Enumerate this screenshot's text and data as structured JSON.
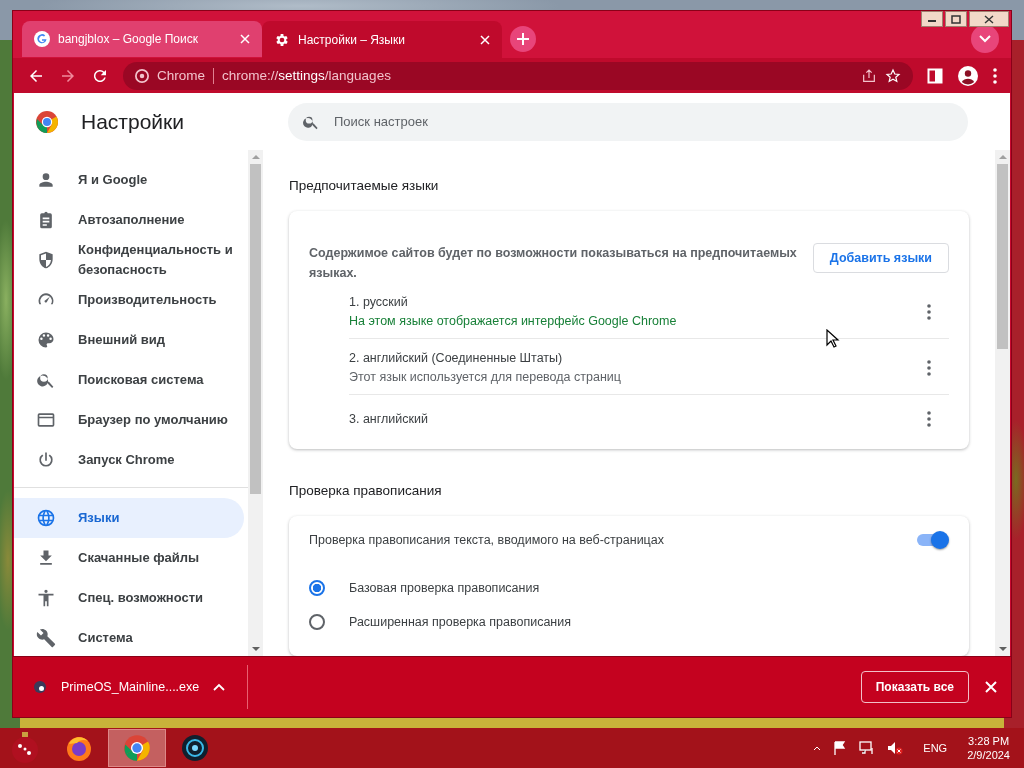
{
  "tabs": [
    {
      "title": "bangjblox – Google Поиск",
      "selected": false
    },
    {
      "title": "Настройки – Языки",
      "selected": true
    }
  ],
  "address_bar": {
    "site_chip": "Chrome",
    "url": "chrome://**settings**/languages"
  },
  "settings": {
    "title": "Настройки",
    "search": {
      "placeholder": "Поиск настроек"
    },
    "nav": [
      {
        "label": "Я и Google",
        "selected": false
      },
      {
        "label": "Автозаполнение",
        "selected": false
      },
      {
        "label": "Конфиденциальность и безопасность",
        "selected": false
      },
      {
        "label": "Производительность",
        "selected": false
      },
      {
        "label": "Внешний вид",
        "selected": false
      },
      {
        "label": "Поисковая система",
        "selected": false
      },
      {
        "label": "Браузер по умолчанию",
        "selected": false
      },
      {
        "label": "Запуск Chrome",
        "selected": false
      },
      {
        "label": "Языки",
        "selected": true
      },
      {
        "label": "Скачанные файлы",
        "selected": false
      },
      {
        "label": "Спец. возможности",
        "selected": false
      },
      {
        "label": "Система",
        "selected": false
      }
    ],
    "languages": {
      "heading": "Предпочитаемые языки",
      "description": "Содержимое сайтов будет по возможности показываться на предпочитаемых языках.",
      "add_button": "Добавить языки",
      "items": [
        {
          "name": "1. русский",
          "note": "На этом языке отображается интерфейс Google Chrome",
          "color": "#188038"
        },
        {
          "name": "2. английский (Соединенные Штаты)",
          "note": "Этот язык используется для перевода страниц",
          "color": "#5f6368"
        },
        {
          "name": "3. английский"
        }
      ]
    },
    "spellcheck": {
      "heading": "Проверка правописания",
      "toggle_label": "Проверка правописания текста, вводимого на веб-страницах",
      "on": true,
      "options": [
        {
          "label": "Базовая проверка правописания",
          "selected": true
        },
        {
          "label": "Расширенная проверка правописания",
          "selected": false
        }
      ]
    }
  },
  "download_bar": {
    "file": "PrimeOS_Mainline....exe",
    "show_all": "Показать все"
  },
  "taskbar": {
    "apps": [
      {
        "kind": "firefox",
        "selected": false
      },
      {
        "kind": "chrome",
        "selected": true
      },
      {
        "kind": "orb",
        "selected": false
      }
    ],
    "language": "ENG",
    "time": "3:28 PM",
    "date": "2/9/2024"
  }
}
